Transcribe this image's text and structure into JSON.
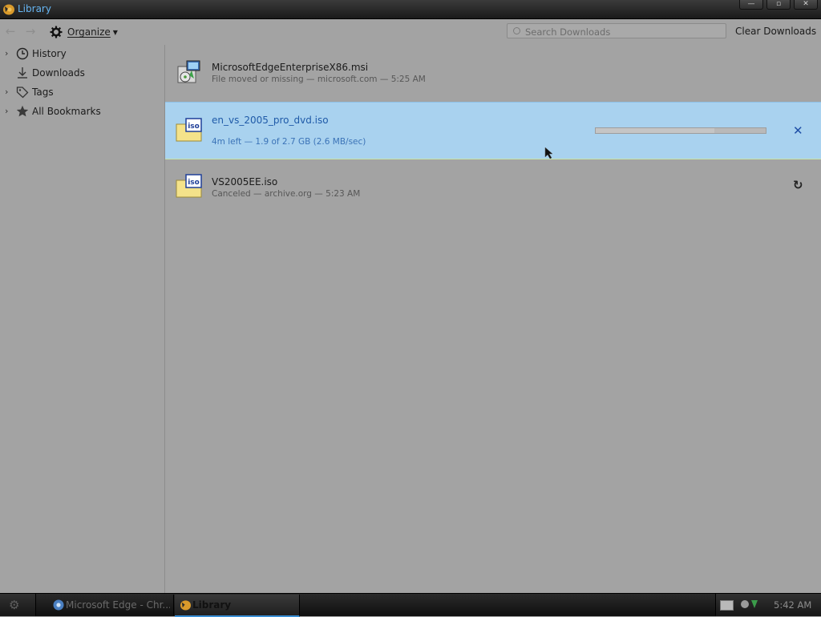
{
  "window": {
    "title": "Library"
  },
  "toolbar": {
    "organize_label": "Organize",
    "search_placeholder": "Search Downloads",
    "clear_label": "Clear Downloads"
  },
  "sidebar": {
    "items": [
      {
        "label": "History",
        "icon": "clock-icon",
        "expandable": true
      },
      {
        "label": "Downloads",
        "icon": "download-arrow-icon",
        "expandable": false
      },
      {
        "label": "Tags",
        "icon": "tag-icon",
        "expandable": true
      },
      {
        "label": "All Bookmarks",
        "icon": "star-icon",
        "expandable": true
      }
    ]
  },
  "downloads": [
    {
      "name": "MicrosoftEdgeEnterpriseX86.msi",
      "status": "File moved or missing — microsoft.com — 5:25 AM",
      "icon": "msi-installer-icon",
      "state": "missing"
    },
    {
      "name": "en_vs_2005_pro_dvd.iso",
      "status": "4m left — 1.9 of 2.7 GB (2.6 MB/sec)",
      "icon": "iso-file-icon",
      "state": "downloading",
      "progress_percent": 70
    },
    {
      "name": "VS2005EE.iso",
      "status": "Canceled — archive.org — 5:23 AM",
      "icon": "iso-file-icon",
      "state": "canceled"
    }
  ],
  "taskbar": {
    "apps": [
      {
        "label": "Microsoft Edge - Chr...",
        "icon": "chrome-icon",
        "active": false
      },
      {
        "label": "Library",
        "icon": "firefox-icon",
        "active": true
      }
    ],
    "clock": "5:42 AM"
  },
  "colors": {
    "accent": "#67b7f5",
    "selection": "#a9d2ef",
    "link_blue": "#1f5aa8",
    "background": "#a3a3a3"
  }
}
